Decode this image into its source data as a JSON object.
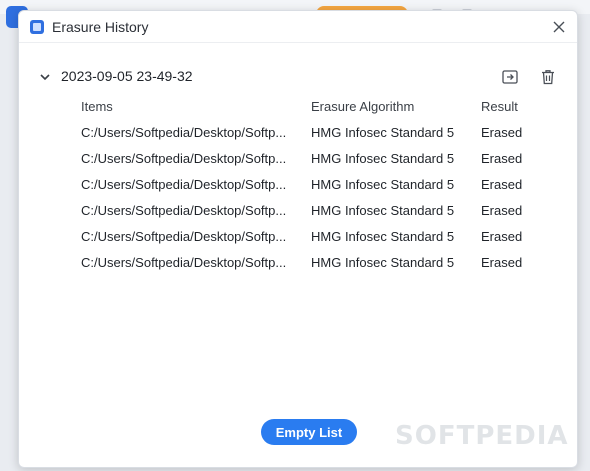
{
  "dialog": {
    "title": "Erasure History",
    "group": {
      "date": "2023-09-05 23-49-32"
    },
    "columns": {
      "items": "Items",
      "algorithm": "Erasure Algorithm",
      "result": "Result"
    },
    "rows": [
      {
        "item": "C:/Users/Softpedia/Desktop/Softp...",
        "algorithm": "HMG Infosec Standard 5",
        "result": "Erased"
      },
      {
        "item": "C:/Users/Softpedia/Desktop/Softp...",
        "algorithm": "HMG Infosec Standard 5",
        "result": "Erased"
      },
      {
        "item": "C:/Users/Softpedia/Desktop/Softp...",
        "algorithm": "HMG Infosec Standard 5",
        "result": "Erased"
      },
      {
        "item": "C:/Users/Softpedia/Desktop/Softp...",
        "algorithm": "HMG Infosec Standard 5",
        "result": "Erased"
      },
      {
        "item": "C:/Users/Softpedia/Desktop/Softp...",
        "algorithm": "HMG Infosec Standard 5",
        "result": "Erased"
      },
      {
        "item": "C:/Users/Softpedia/Desktop/Softp...",
        "algorithm": "HMG Infosec Standard 5",
        "result": "Erased"
      }
    ],
    "empty_button": "Empty List"
  },
  "watermark": "SOFTPEDIA",
  "icons": {
    "app": "app-icon",
    "close": "close-icon",
    "chevron": "chevron-down-icon",
    "export": "export-icon",
    "delete": "trash-icon"
  },
  "colors": {
    "accent": "#2a7cf0",
    "background_orange": "#f4a640"
  }
}
